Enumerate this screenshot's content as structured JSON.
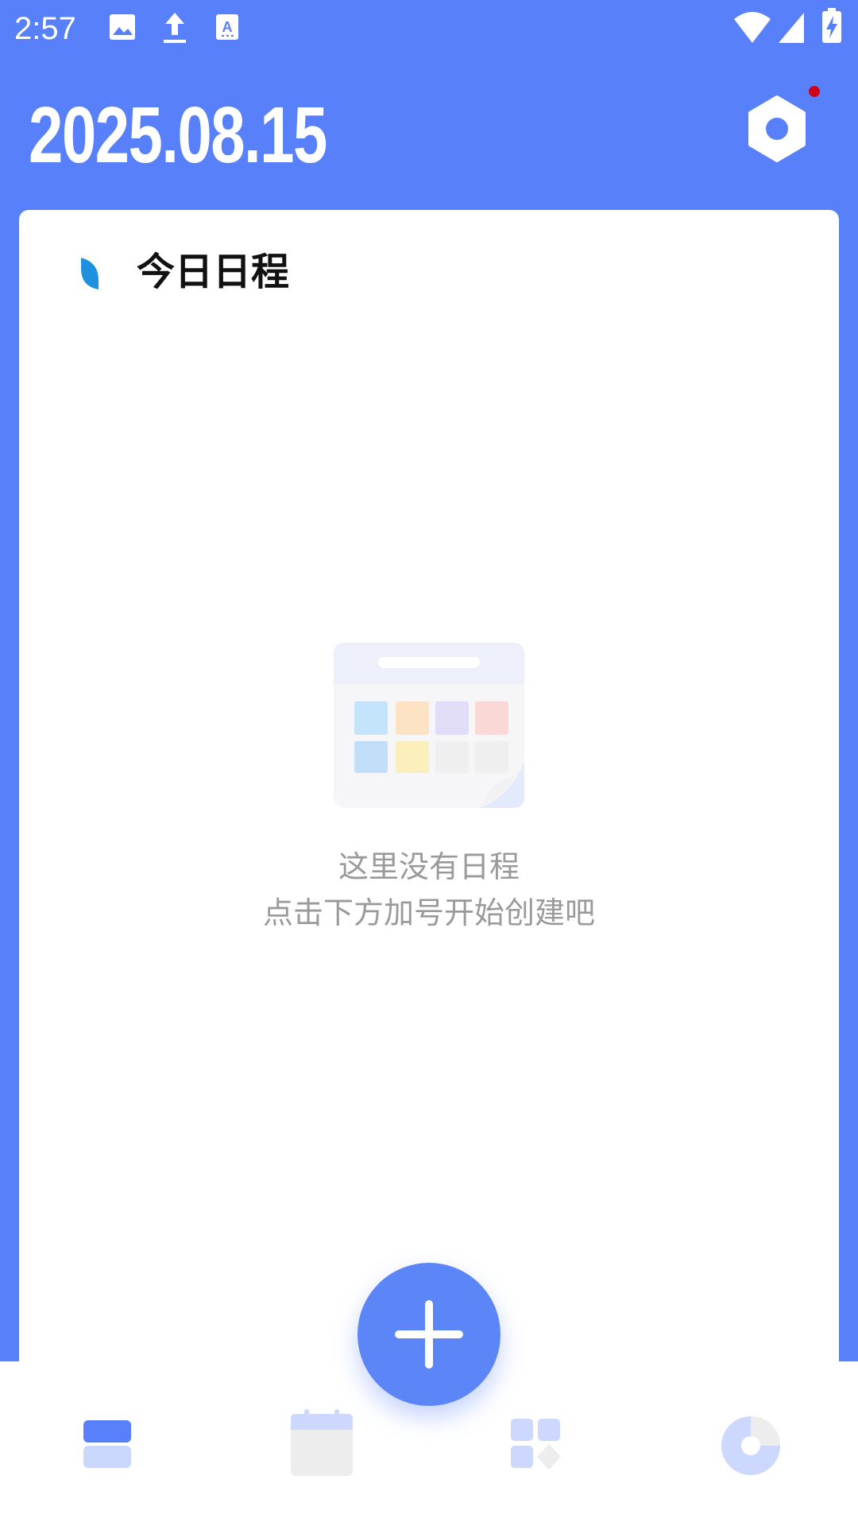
{
  "status_bar": {
    "time": "2:57",
    "icons": [
      "image-icon",
      "upload-icon",
      "text-recognition-icon",
      "wifi-icon",
      "signal-icon",
      "battery-charging-icon"
    ]
  },
  "header": {
    "date": "2025.08.15",
    "settings_icon": "hexagon-settings-icon",
    "has_notification": true
  },
  "card": {
    "title": "今日日程",
    "empty_state": {
      "line1": "这里没有日程",
      "line2": "点击下方加号开始创建吧"
    }
  },
  "fab": {
    "icon": "plus-icon"
  },
  "bottom_nav": {
    "items": [
      {
        "icon": "list-icon",
        "active": true
      },
      {
        "icon": "calendar-icon",
        "active": false
      },
      {
        "icon": "widgets-icon",
        "active": false
      },
      {
        "icon": "pie-chart-icon",
        "active": false
      }
    ]
  },
  "colors": {
    "primary": "#5880FA",
    "fab": "#5C86F8",
    "title_accent": "#1E90E0",
    "notification_dot": "#D0021B",
    "empty_text": "#9A9A9A"
  }
}
